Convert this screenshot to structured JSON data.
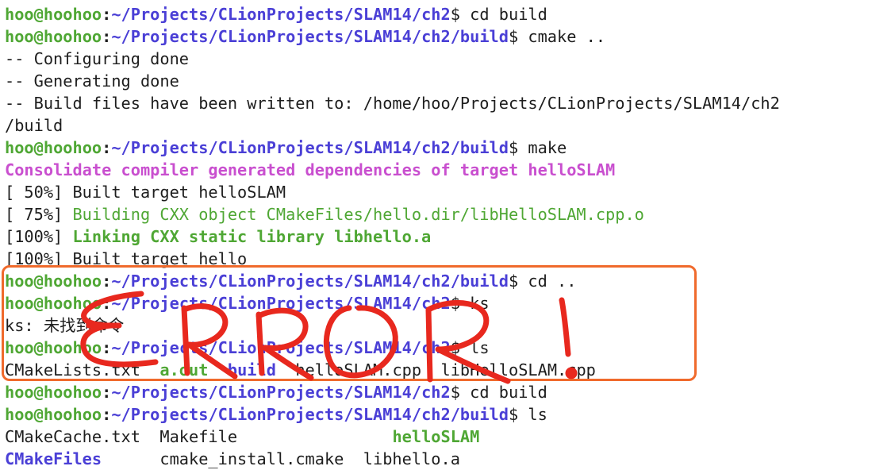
{
  "prompt": {
    "user": "hoo",
    "at": "@",
    "host": "hoohoo",
    "colon": ":",
    "dollar": "$ "
  },
  "lines": [
    {
      "type": "prompt",
      "path": "~/Projects/CLionProjects/SLAM14/ch2",
      "command": "cd build"
    },
    {
      "type": "prompt",
      "path": "~/Projects/CLionProjects/SLAM14/ch2/build",
      "command": "cmake .."
    },
    {
      "type": "text",
      "text": "-- Configuring done"
    },
    {
      "type": "text",
      "text": "-- Generating done"
    },
    {
      "type": "text",
      "text": "-- Build files have been written to: /home/hoo/Projects/CLionProjects/SLAM14/ch2"
    },
    {
      "type": "text",
      "text": "/build"
    },
    {
      "type": "prompt",
      "path": "~/Projects/CLionProjects/SLAM14/ch2/build",
      "command": "make"
    },
    {
      "type": "text",
      "text": "Consolidate compiler generated dependencies of target helloSLAM",
      "style": "magenta bold"
    },
    {
      "type": "progress",
      "percent": "[ 50%]",
      "text": " Built target helloSLAM",
      "style": "plain"
    },
    {
      "type": "progress",
      "percent": "[ 75%]",
      "text": " Building CXX object CMakeFiles/hello.dir/libHelloSLAM.cpp.o",
      "style": "green"
    },
    {
      "type": "progress",
      "percent": "[100%]",
      "text": " Linking CXX static library libhello.a",
      "style": "green bold"
    },
    {
      "type": "progress",
      "percent": "[100%]",
      "text": " Built target hello",
      "style": "plain"
    },
    {
      "type": "prompt",
      "path": "~/Projects/CLionProjects/SLAM14/ch2/build",
      "command": "cd .."
    },
    {
      "type": "prompt",
      "path": "~/Projects/CLionProjects/SLAM14/ch2",
      "command": "ks"
    },
    {
      "type": "text",
      "text": "ks: 未找到命令"
    },
    {
      "type": "prompt",
      "path": "~/Projects/CLionProjects/SLAM14/ch2",
      "command": "ls"
    },
    {
      "type": "ls",
      "items": [
        {
          "name": "CMakeLists.txt",
          "style": "plain",
          "pad": "  "
        },
        {
          "name": "a.out",
          "style": "green bold",
          "pad": "  "
        },
        {
          "name": "build",
          "style": "blue bold",
          "pad": "  "
        },
        {
          "name": "helloSLAM.cpp",
          "style": "plain",
          "pad": "  "
        },
        {
          "name": "libHelloSLAM.cpp",
          "style": "plain",
          "pad": ""
        }
      ]
    },
    {
      "type": "prompt",
      "path": "~/Projects/CLionProjects/SLAM14/ch2",
      "command": "cd build"
    },
    {
      "type": "prompt",
      "path": "~/Projects/CLionProjects/SLAM14/ch2/build",
      "command": "ls"
    },
    {
      "type": "ls",
      "items": [
        {
          "name": "CMakeCache.txt",
          "style": "plain",
          "pad": "  "
        },
        {
          "name": "Makefile",
          "style": "plain",
          "pad": "                "
        },
        {
          "name": "helloSLAM",
          "style": "green bold",
          "pad": ""
        }
      ]
    },
    {
      "type": "ls",
      "items": [
        {
          "name": "CMakeFiles",
          "style": "blue bold",
          "pad": "      "
        },
        {
          "name": "cmake_install.cmake",
          "style": "plain",
          "pad": "  "
        },
        {
          "name": "libhello.a",
          "style": "plain",
          "pad": ""
        }
      ]
    }
  ],
  "annotation": {
    "scribble_text": "ERROR!",
    "box_color": "#f06a2c",
    "scribble_color": "#e8281e"
  },
  "colors": {
    "prompt_user": "#4fa734",
    "prompt_path": "#4a3fd6",
    "magenta": "#c94fcf",
    "text": "#1e1e1e"
  }
}
